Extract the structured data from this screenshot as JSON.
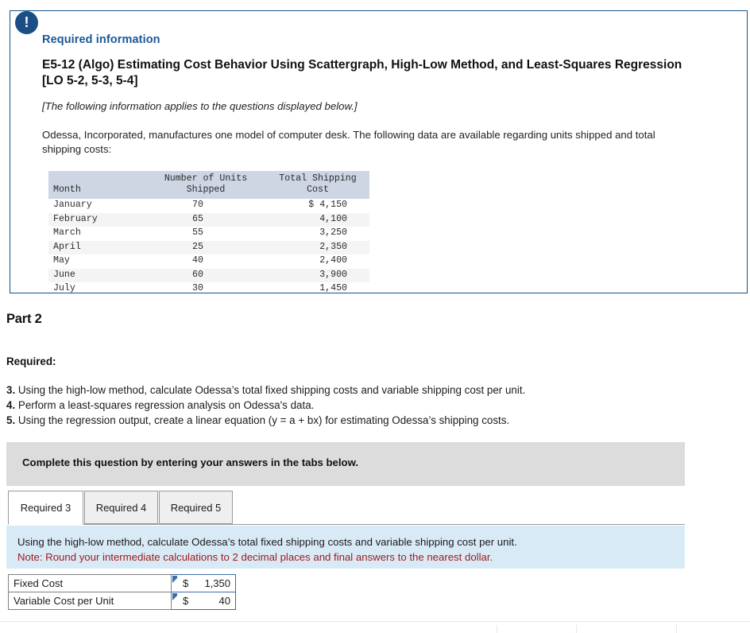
{
  "info_panel": {
    "badge_icon": "exclamation-icon",
    "required_info_label": "Required information",
    "problem_title": "E5-12 (Algo) Estimating Cost Behavior Using Scattergraph, High-Low Method, and Least-Squares Regression [LO 5-2, 5-3, 5-4]",
    "applies_note": "[The following information applies to the questions displayed below.]",
    "intro_paragraph": "Odessa, Incorporated, manufactures one model of computer desk. The following data are available regarding units shipped and total shipping costs:",
    "table": {
      "headers": {
        "month": "Month",
        "units": "Number of Units Shipped",
        "units_line1": "Number of Units",
        "units_line2": "Shipped",
        "cost": "Total Shipping Cost",
        "cost_line1": "Total Shipping",
        "cost_line2": "Cost"
      },
      "rows": [
        {
          "month": "January",
          "units": "70",
          "cost": "$ 4,150"
        },
        {
          "month": "February",
          "units": "65",
          "cost": "4,100"
        },
        {
          "month": "March",
          "units": "55",
          "cost": "3,250"
        },
        {
          "month": "April",
          "units": "25",
          "cost": "2,350"
        },
        {
          "month": "May",
          "units": "40",
          "cost": "2,400"
        },
        {
          "month": "June",
          "units": "60",
          "cost": "3,900"
        },
        {
          "month": "July",
          "units": "30",
          "cost": "1,450"
        }
      ]
    }
  },
  "part": {
    "heading": "Part 2",
    "required_heading": "Required:",
    "requirements": [
      {
        "num": "3.",
        "text": "Using the high-low method, calculate Odessa’s total fixed shipping costs and variable shipping cost per unit."
      },
      {
        "num": "4.",
        "text": "Perform a least-squares regression analysis on Odessa's data."
      },
      {
        "num": "5.",
        "text": "Using the regression output, create a linear equation (y = a + bx) for estimating Odessa’s shipping costs."
      }
    ]
  },
  "complete_banner": {
    "text": "Complete this question by entering your answers in the tabs below."
  },
  "tabs": [
    {
      "label": "Required 3",
      "active": true
    },
    {
      "label": "Required 4",
      "active": false
    },
    {
      "label": "Required 5",
      "active": false
    }
  ],
  "note_banner": {
    "line1": "Using the high-low method, calculate Odessa’s total fixed shipping costs and variable shipping cost per unit.",
    "line2": "Note: Round your intermediate calculations to 2 decimal places and final answers to the nearest dollar."
  },
  "answer_table": {
    "rows": [
      {
        "label": "Fixed Cost",
        "currency": "$",
        "value": "1,350"
      },
      {
        "label": "Variable Cost per Unit",
        "currency": "$",
        "value": "40"
      }
    ]
  },
  "colors": {
    "panel_border": "#14538c",
    "badge": "#1a4e85",
    "required_info": "#1a5799",
    "table_header_bg": "#ced6e4",
    "table_stripe": "#f4f4f4",
    "gray_banner": "#dcdcdc",
    "blue_banner": "#d9eaf7",
    "note_red": "#a11a1a",
    "input_border": "#3b6ea8"
  }
}
